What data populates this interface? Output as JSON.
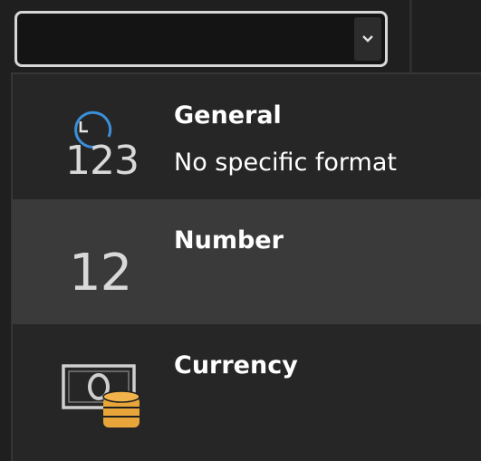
{
  "combo": {
    "value": ""
  },
  "menu": {
    "items": [
      {
        "title": "General",
        "description": "No specific format",
        "icon": "clock-123-icon",
        "icon_digits": "123",
        "selected": false
      },
      {
        "title": "Number",
        "description": "",
        "icon": "number-12-icon",
        "icon_digits": "12",
        "selected": true
      },
      {
        "title": "Currency",
        "description": "",
        "icon": "currency-coins-icon",
        "icon_digits": "",
        "selected": false
      }
    ]
  },
  "colors": {
    "background": "#1f1f1f",
    "dropdown": "#262626",
    "selected_row": "#3a3a3a",
    "accent_blue": "#3b8fd9",
    "coin_gold": "#e8a53a"
  }
}
